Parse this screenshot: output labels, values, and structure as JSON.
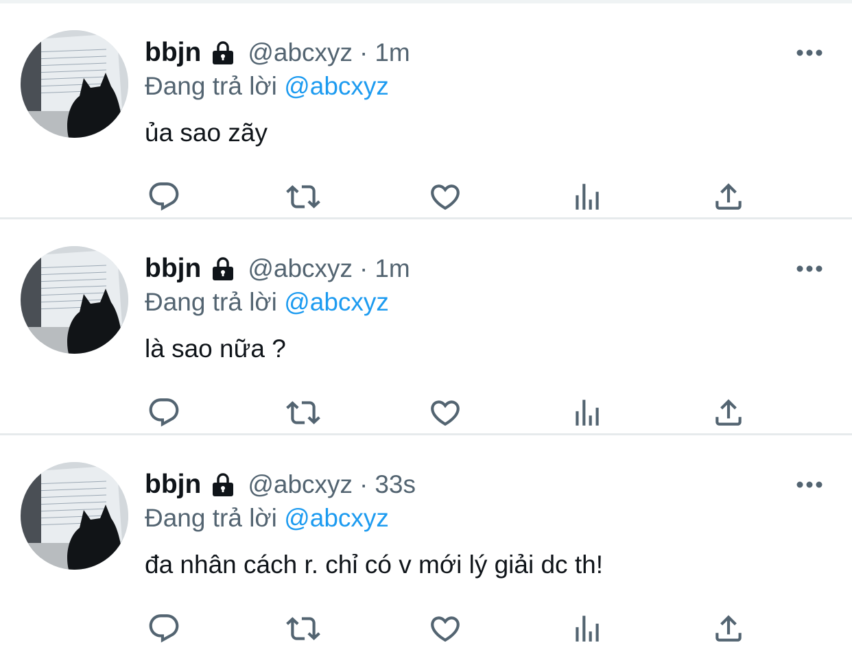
{
  "colors": {
    "accent": "#1d9bf0",
    "secondary_text": "#536471",
    "icon": "#536471"
  },
  "tweets": [
    {
      "author_name": "bbjn",
      "author_handle": "@abcxyz",
      "separator": "·",
      "time": "1m",
      "replying_label": "Đang trả lời",
      "replying_to": "@abcxyz",
      "text": "ủa sao zãy",
      "icons": [
        "lock-icon",
        "more-icon",
        "reply-icon",
        "retweet-icon",
        "like-icon",
        "views-icon",
        "share-icon"
      ]
    },
    {
      "author_name": "bbjn",
      "author_handle": "@abcxyz",
      "separator": "·",
      "time": "1m",
      "replying_label": "Đang trả lời",
      "replying_to": "@abcxyz",
      "text": "là sao nữa ?",
      "icons": [
        "lock-icon",
        "more-icon",
        "reply-icon",
        "retweet-icon",
        "like-icon",
        "views-icon",
        "share-icon"
      ]
    },
    {
      "author_name": "bbjn",
      "author_handle": "@abcxyz",
      "separator": "·",
      "time": "33s",
      "replying_label": "Đang trả lời",
      "replying_to": "@abcxyz",
      "text": "đa nhân cách r. chỉ có v mới lý giải dc th!",
      "icons": [
        "lock-icon",
        "more-icon",
        "reply-icon",
        "retweet-icon",
        "like-icon",
        "views-icon",
        "share-icon"
      ]
    }
  ]
}
